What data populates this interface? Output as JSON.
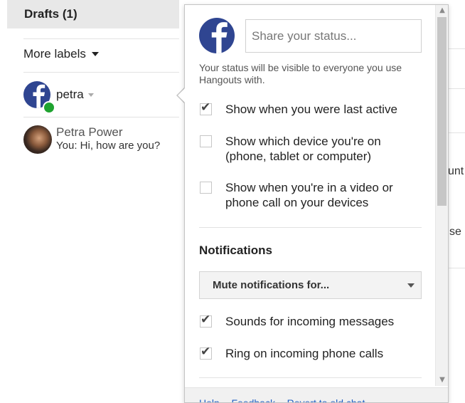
{
  "sidebar": {
    "drafts_label": "Drafts (1)",
    "more_labels": "More labels",
    "me_name": "petra",
    "contacts": [
      {
        "name": "Petra Power",
        "message": "You: Hi, how are you?"
      }
    ]
  },
  "background_fragments": [
    "unt",
    "se"
  ],
  "popup": {
    "status_placeholder": "Share your status...",
    "status_value": "",
    "status_note": "Your status will be visible to everyone you use Hangouts with.",
    "privacy_options": [
      {
        "label": "Show when you were last active",
        "checked": true
      },
      {
        "label": "Show which device you're on (phone, tablet or computer)",
        "checked": false
      },
      {
        "label": "Show when you're in a video or phone call on your devices",
        "checked": false
      }
    ],
    "notifications_title": "Notifications",
    "mute_select_label": "Mute notifications for...",
    "notification_options": [
      {
        "label": "Sounds for incoming messages",
        "checked": true
      },
      {
        "label": "Ring on incoming phone calls",
        "checked": true
      }
    ],
    "footer_links": [
      "Help",
      "Feedback",
      "Revert to old chat"
    ]
  },
  "colors": {
    "brand_blue": "#2f4591",
    "online_green": "#1fa330",
    "link_blue": "#1f5fc4",
    "drafts_bg": "#e8e8e8"
  },
  "icons": {
    "avatar": "facebook-f-icon",
    "status_dot": "online-dot-icon",
    "checkbox_checked": "check-icon"
  }
}
